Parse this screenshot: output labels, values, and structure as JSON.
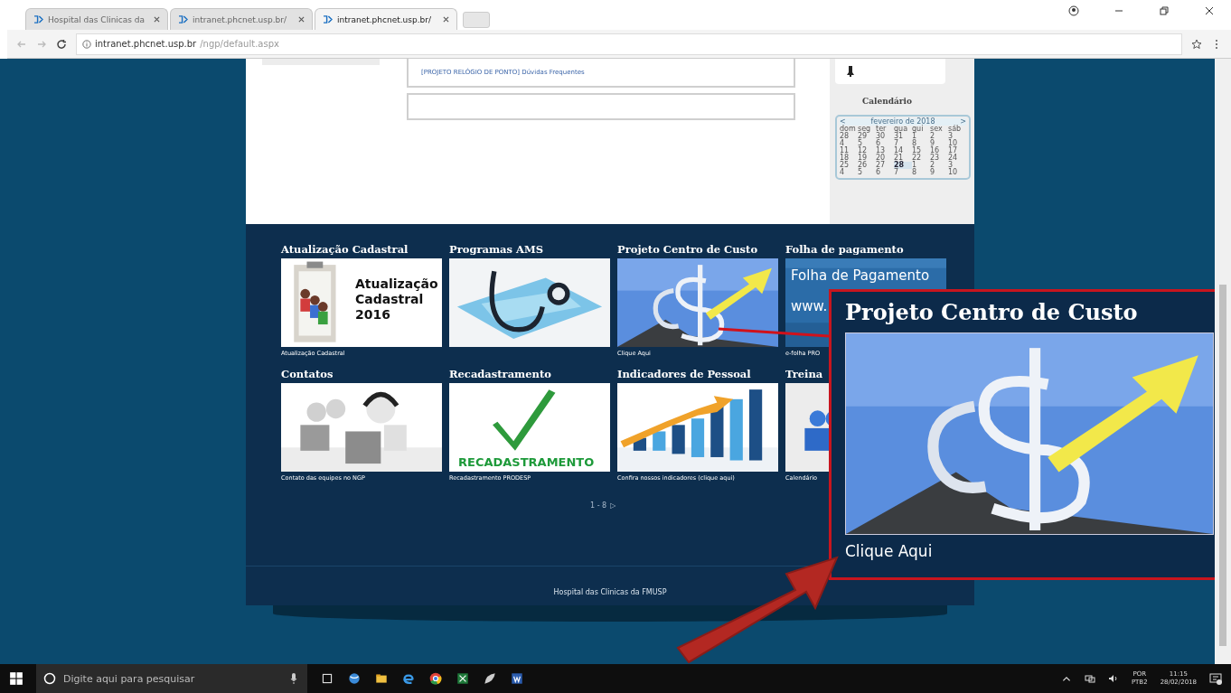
{
  "browser": {
    "tabs": [
      {
        "label": "Hospital das Clinicas da",
        "selected": false
      },
      {
        "label": "intranet.phcnet.usp.br/",
        "selected": false
      },
      {
        "label": "intranet.phcnet.usp.br/",
        "selected": true
      }
    ],
    "url_host": "intranet.phcnet.usp.br",
    "url_path": "/ngp/default.aspx"
  },
  "news": {
    "link": "[PROJETO RELÓGIO DE PONTO] Dúvidas Frequentes"
  },
  "sidebar": {
    "calendar_title": "Calendário",
    "calendar": {
      "prev": "<",
      "month": "fevereiro de 2018",
      "next": ">",
      "day_names": [
        "dom",
        "seg",
        "ter",
        "qua",
        "qui",
        "sex",
        "sáb"
      ],
      "weeks": [
        [
          {
            "d": "28",
            "today": false
          },
          {
            "d": "29",
            "today": false
          },
          {
            "d": "30",
            "today": false
          },
          {
            "d": "31",
            "today": false
          },
          {
            "d": "1",
            "today": false
          },
          {
            "d": "2",
            "today": false
          },
          {
            "d": "3",
            "today": false
          }
        ],
        [
          {
            "d": "4",
            "today": false
          },
          {
            "d": "5",
            "today": false
          },
          {
            "d": "6",
            "today": false
          },
          {
            "d": "7",
            "today": false
          },
          {
            "d": "8",
            "today": false
          },
          {
            "d": "9",
            "today": false
          },
          {
            "d": "10",
            "today": false
          }
        ],
        [
          {
            "d": "11",
            "today": false
          },
          {
            "d": "12",
            "today": false
          },
          {
            "d": "13",
            "today": false
          },
          {
            "d": "14",
            "today": false
          },
          {
            "d": "15",
            "today": false
          },
          {
            "d": "16",
            "today": false
          },
          {
            "d": "17",
            "today": false
          }
        ],
        [
          {
            "d": "18",
            "today": false
          },
          {
            "d": "19",
            "today": false
          },
          {
            "d": "20",
            "today": false
          },
          {
            "d": "21",
            "today": false
          },
          {
            "d": "22",
            "today": false
          },
          {
            "d": "23",
            "today": false
          },
          {
            "d": "24",
            "today": false
          }
        ],
        [
          {
            "d": "25",
            "today": false
          },
          {
            "d": "26",
            "today": false
          },
          {
            "d": "27",
            "today": false
          },
          {
            "d": "28",
            "today": true
          },
          {
            "d": "1",
            "today": false
          },
          {
            "d": "2",
            "today": false
          },
          {
            "d": "3",
            "today": false
          }
        ],
        [
          {
            "d": "4",
            "today": false
          },
          {
            "d": "5",
            "today": false
          },
          {
            "d": "6",
            "today": false
          },
          {
            "d": "7",
            "today": false
          },
          {
            "d": "8",
            "today": false
          },
          {
            "d": "9",
            "today": false
          },
          {
            "d": "10",
            "today": false
          }
        ]
      ]
    }
  },
  "tiles": [
    {
      "heading": "Atualização Cadastral",
      "banner_text": [
        "Atualização",
        "Cadastral",
        "2016"
      ],
      "caption": "Atualização Cadastral"
    },
    {
      "heading": "Programas AMS"
    },
    {
      "heading": "Projeto Centro de Custo",
      "caption": "Clique Aqui"
    },
    {
      "heading": "Folha de pagamento",
      "banner_text": [
        "Folha de Pagamento",
        "www."
      ],
      "caption": "e-folha PRO"
    },
    {
      "heading": "Contatos",
      "caption": "Contato das equipes no NGP"
    },
    {
      "heading": "Recadastramento",
      "banner_text": [
        "RECADASTRAMENTO"
      ],
      "caption": "Recadastramento PRODESP"
    },
    {
      "heading": "Indicadores de Pessoal",
      "caption": "Confira nossos indicadores (clique aqui)"
    },
    {
      "heading": "Treina",
      "caption": "Calendário"
    }
  ],
  "pager": {
    "range": "1 - 8",
    "next": "▷"
  },
  "footer": "Hospital das Clinicas da FMUSP",
  "callout": {
    "title": "Projeto Centro de Custo",
    "link": "Clique Aqui"
  },
  "taskbar": {
    "search_placeholder": "Digite aqui para pesquisar",
    "language": "POR",
    "layout": "PTB2",
    "time": "11:15",
    "date": "28/02/2018"
  }
}
